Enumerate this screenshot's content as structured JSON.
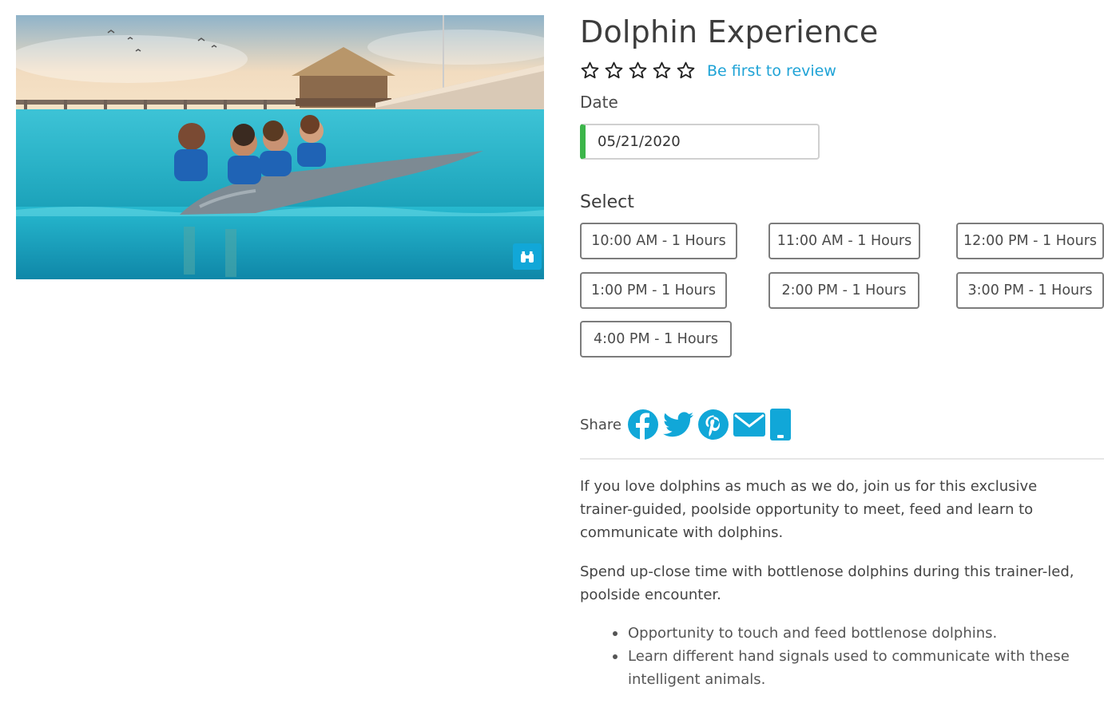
{
  "hero": {
    "alt": "Dolphin swim photo",
    "gallery_icon": "binoculars-icon"
  },
  "product": {
    "title": "Dolphin Experience",
    "rating": {
      "value": 0,
      "max": 5,
      "review_link": "Be first to review"
    },
    "date_label": "Date",
    "date_value": "05/21/2020",
    "select_label": "Select",
    "time_slots": [
      "10:00 AM - 1 Hours",
      "11:00 AM - 1 Hours",
      "12:00 PM - 1 Hours",
      "1:00 PM - 1 Hours",
      "2:00 PM - 1 Hours",
      "3:00 PM - 1 Hours",
      "4:00 PM - 1 Hours"
    ],
    "share_label": "Share",
    "share_icons": [
      "facebook-icon",
      "twitter-icon",
      "pinterest-icon",
      "email-icon",
      "mobile-icon"
    ],
    "description": [
      "If you love dolphins as much as we do, join us for this exclusive trainer-guided, poolside opportunity to meet, feed and learn to communicate with dolphins.",
      "Spend up-close time with bottlenose dolphins during this trainer-led, poolside encounter."
    ],
    "highlights": [
      "Opportunity to touch and feed bottlenose dolphins.",
      "Learn different hand signals used to communicate with these intelligent animals."
    ]
  },
  "colors": {
    "accent": "#1fa3d6",
    "share_icon": "#11a7d8",
    "date_indicator": "#3cb54a",
    "slot_border": "#7c7c7c"
  }
}
